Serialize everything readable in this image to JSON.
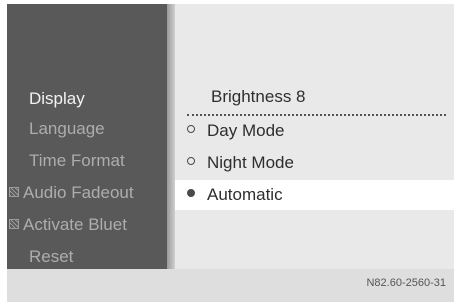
{
  "left_menu": {
    "items": [
      {
        "label": "Display",
        "state": "active",
        "checkbox": false
      },
      {
        "label": "Language",
        "state": "inactive",
        "checkbox": false
      },
      {
        "label": "Time Format",
        "state": "inactive",
        "checkbox": false
      },
      {
        "label": "Audio Fadeout",
        "state": "inactive",
        "checkbox": true
      },
      {
        "label": "Activate Bluet",
        "state": "inactive",
        "checkbox": true
      },
      {
        "label": "Reset",
        "state": "inactive",
        "checkbox": false
      }
    ]
  },
  "display_submenu": {
    "brightness_label": "Brightness 8",
    "modes": [
      {
        "label": "Day Mode",
        "selected": false
      },
      {
        "label": "Night Mode",
        "selected": false
      },
      {
        "label": "Automatic",
        "selected": true
      }
    ]
  },
  "footer": {
    "reference_code": "N82.60-2560-31"
  },
  "colors": {
    "menu_bg": "#595959",
    "panel_bg": "#e9e9e9",
    "highlight": "#ffffff"
  }
}
